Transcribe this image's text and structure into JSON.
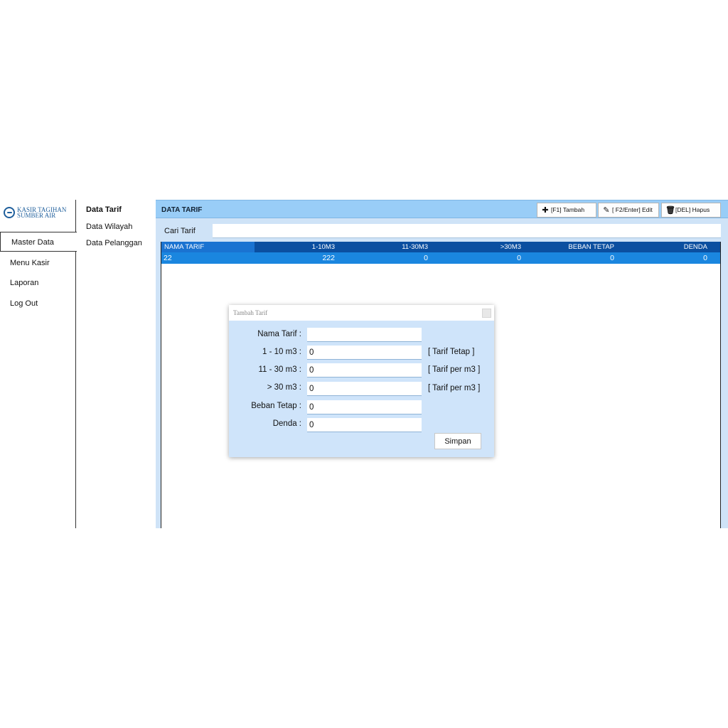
{
  "logo": {
    "line1": "KASIR TAGIHAN",
    "line2": "SUMBER AIR"
  },
  "nav": {
    "items": [
      "Master Data",
      "Menu Kasir",
      "Laporan",
      "Log Out"
    ]
  },
  "submenu": {
    "items": [
      "Data Tarif",
      "Data Wilayah",
      "Data Pelanggan"
    ]
  },
  "header": {
    "title": "DATA TARIF",
    "buttons": {
      "add": "[F1] Tambah",
      "edit": "[ F2/Enter] Edit",
      "delete": "[DEL] Hapus"
    }
  },
  "search": {
    "label": "Cari Tarif",
    "value": ""
  },
  "table": {
    "columns": [
      "NAMA TARIF",
      "1-10M3",
      "11-30M3",
      ">30M3",
      "BEBAN TETAP",
      "DENDA"
    ],
    "rows": [
      [
        "22",
        "222",
        "0",
        "0",
        "0",
        "0"
      ]
    ]
  },
  "dialog": {
    "title": "Tambah Tarif",
    "fields": [
      {
        "label": "Nama Tarif :",
        "value": ""
      },
      {
        "label": "1 - 10 m3 :",
        "value": "0",
        "hint": "[ Tarif Tetap ]"
      },
      {
        "label": "11 - 30 m3 :",
        "value": "0",
        "hint": "[ Tarif per m3 ]"
      },
      {
        "label": "> 30 m3 :",
        "value": "0",
        "hint": "[ Tarif per m3 ]"
      },
      {
        "label": "Beban Tetap :",
        "value": "0"
      },
      {
        "label": "Denda :",
        "value": "0"
      }
    ],
    "save_label": "Simpan"
  },
  "icons": {
    "add": "plus-icon",
    "edit": "pencil-icon",
    "delete": "trash-icon",
    "close": "close-icon",
    "logo": "water-drop-logo"
  },
  "colors": {
    "header": "#99cdf7",
    "grid_head": "#0b4fa0",
    "selected_row": "#1a86df",
    "dialog_bg": "#cfe4fa"
  }
}
